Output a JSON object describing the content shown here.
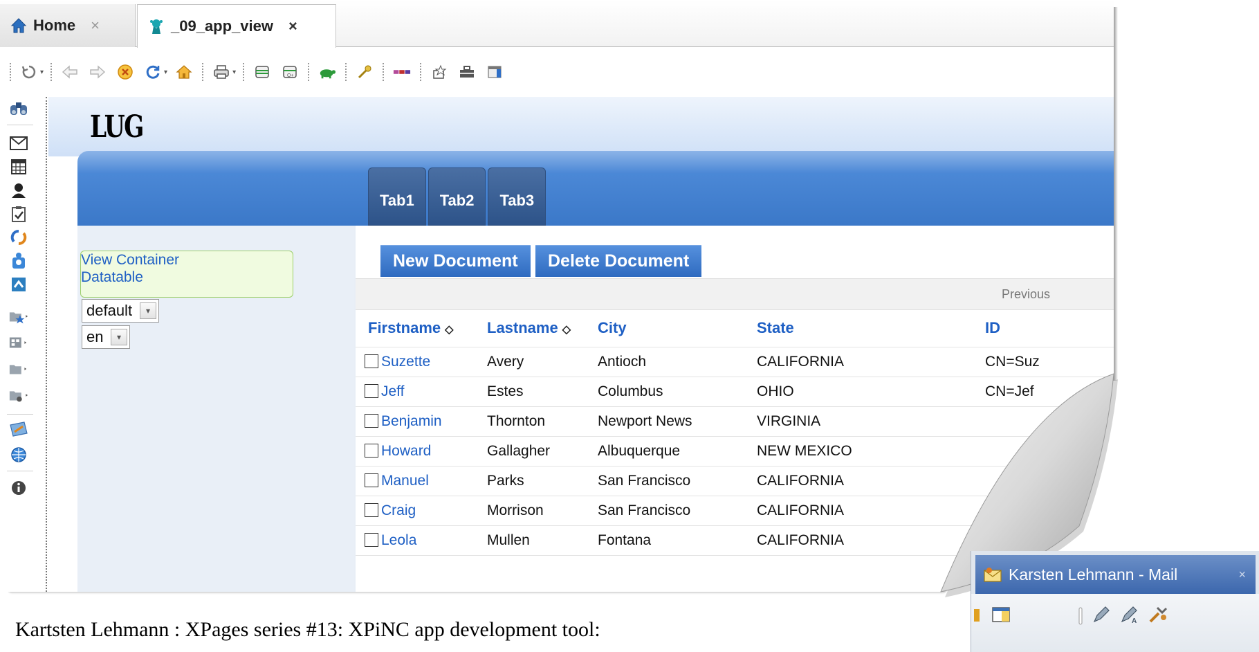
{
  "window_tabs": [
    {
      "label": "Home",
      "icon": "home-icon"
    },
    {
      "label": "_09_app_view",
      "icon": "app-icon"
    }
  ],
  "tab_close_glyph": "×",
  "toolbar": {
    "icons": [
      "reload-icon",
      "back-icon",
      "forward-icon",
      "stop-icon",
      "refresh-icon",
      "home-icon",
      "print-icon",
      "database-icon",
      "database-search-icon",
      "turtle-icon",
      "key-icon",
      "tags-icon",
      "applet-icon",
      "toolbox-icon",
      "layout-icon"
    ]
  },
  "sidebar": {
    "icons": [
      "search-binoculars-icon",
      "mail-icon",
      "calendar-icon",
      "contacts-icon",
      "todo-icon",
      "sametime-icon",
      "activities-icon",
      "files-icon",
      "favorites-folder-icon",
      "applications-folder-icon",
      "folder-icon",
      "workspace-folder-icon",
      "feeds-icon",
      "web-icon",
      "info-icon"
    ]
  },
  "page": {
    "logo_text": "LUG",
    "tabs": [
      "Tab1",
      "Tab2",
      "Tab3"
    ],
    "theme_select": "default",
    "lang_select": "en",
    "nav_links": [
      "View Container",
      "Datatable"
    ],
    "buttons": {
      "new": "New Document",
      "delete": "Delete Document"
    },
    "pager_prev": "Previous"
  },
  "table": {
    "columns": [
      "Firstname",
      "Lastname",
      "City",
      "State",
      "ID"
    ],
    "sort_glyph": "◇",
    "rows": [
      {
        "first": "Suzette",
        "last": "Avery",
        "city": "Antioch",
        "state": "CALIFORNIA",
        "id": "CN=Suz"
      },
      {
        "first": "Jeff",
        "last": "Estes",
        "city": "Columbus",
        "state": "OHIO",
        "id": "CN=Jef"
      },
      {
        "first": "Benjamin",
        "last": "Thornton",
        "city": "Newport News",
        "state": "VIRGINIA",
        "id": ""
      },
      {
        "first": "Howard",
        "last": "Gallagher",
        "city": "Albuquerque",
        "state": "NEW MEXICO",
        "id": ""
      },
      {
        "first": "Manuel",
        "last": "Parks",
        "city": "San Francisco",
        "state": "CALIFORNIA",
        "id": ""
      },
      {
        "first": "Craig",
        "last": "Morrison",
        "city": "San Francisco",
        "state": "CALIFORNIA",
        "id": ""
      },
      {
        "first": "Leola",
        "last": "Mullen",
        "city": "Fontana",
        "state": "CALIFORNIA",
        "id": ""
      }
    ]
  },
  "caption": "Kartsten Lehmann : XPages series #13: XPiNC app development tool:",
  "mail_window": {
    "title": "Karsten Lehmann - Mail",
    "close": "×"
  },
  "colors": {
    "link_blue": "#1e5fc4",
    "banner_blue": "#3b78c8",
    "tab_dark_blue": "#2d5389",
    "nav_green_bg": "#f0fbe0"
  }
}
